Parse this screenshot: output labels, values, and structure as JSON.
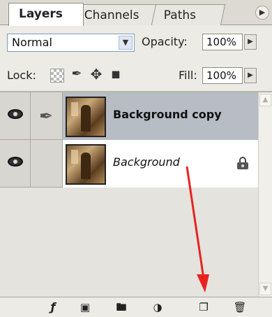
{
  "tabs": [
    {
      "label": "Layers"
    },
    {
      "label": "Channels"
    },
    {
      "label": "Paths"
    }
  ],
  "options": {
    "blend_mode": "Normal",
    "opacity_label": "Opacity:",
    "opacity_value": "100%",
    "lock_label": "Lock:",
    "fill_label": "Fill:",
    "fill_value": "100%"
  },
  "layers": [
    {
      "name": "Background copy",
      "visible": true,
      "selected": true
    },
    {
      "name": "Background",
      "visible": true,
      "locked": true
    }
  ],
  "icons": {
    "tab_menu": "menu-arrow-icon",
    "dropdown": "chevron-down-icon",
    "stepper": "triangle-right-icon",
    "lock_transparent": "lock-transparent-pixels-icon",
    "lock_image": "brush-icon",
    "lock_position": "move-icon",
    "lock_all": "padlock-icon",
    "bottom": [
      "link-layers-icon",
      "add-mask-icon",
      "new-group-icon",
      "adjustment-layer-icon",
      "new-layer-icon",
      "trash-icon"
    ]
  },
  "colors": {
    "selected_row": "#b8bcc4",
    "annotation_arrow": "#e8231f"
  }
}
